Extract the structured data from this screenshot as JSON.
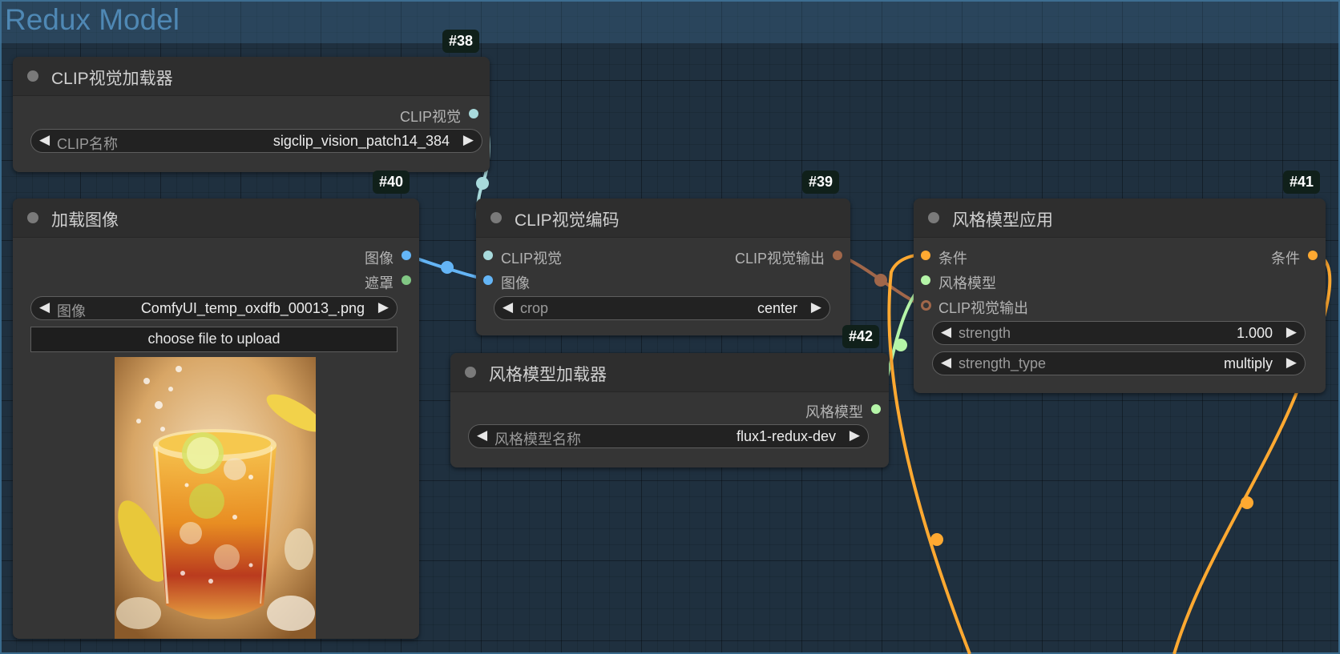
{
  "group": {
    "title": "Redux Model"
  },
  "colors": {
    "clip_vision": "#a8dadc",
    "image": "#64b5f6",
    "mask": "#81c784",
    "clip_vision_output": "#a1674a",
    "style_model": "#b5f5a8",
    "conditioning": "#ffa931"
  },
  "nodes": {
    "clip_loader": {
      "id": "#38",
      "title": "CLIP视觉加载器",
      "output": "CLIP视觉",
      "widget": {
        "label": "CLIP名称",
        "value": "sigclip_vision_patch14_384"
      }
    },
    "load_image": {
      "id": "#40",
      "title": "加载图像",
      "outputs": [
        "图像",
        "遮罩"
      ],
      "widget": {
        "label": "图像",
        "value": "ComfyUI_temp_oxdfb_00013_.png"
      },
      "upload_label": "choose file to upload",
      "preview_icon": "iced-tea-glass-photo"
    },
    "clip_encode": {
      "id": "#39",
      "title": "CLIP视觉编码",
      "inputs": [
        "CLIP视觉",
        "图像"
      ],
      "output": "CLIP视觉输出",
      "widget": {
        "label": "crop",
        "value": "center"
      }
    },
    "style_loader": {
      "id": "#42",
      "title": "风格模型加载器",
      "output": "风格模型",
      "widget": {
        "label": "风格模型名称",
        "value": "flux1-redux-dev"
      }
    },
    "style_apply": {
      "id": "#41",
      "title": "风格模型应用",
      "inputs": [
        "条件",
        "风格模型",
        "CLIP视觉输出"
      ],
      "output": "条件",
      "widgets": [
        {
          "label": "strength",
          "value": "1.000"
        },
        {
          "label": "strength_type",
          "value": "multiply"
        }
      ]
    }
  }
}
